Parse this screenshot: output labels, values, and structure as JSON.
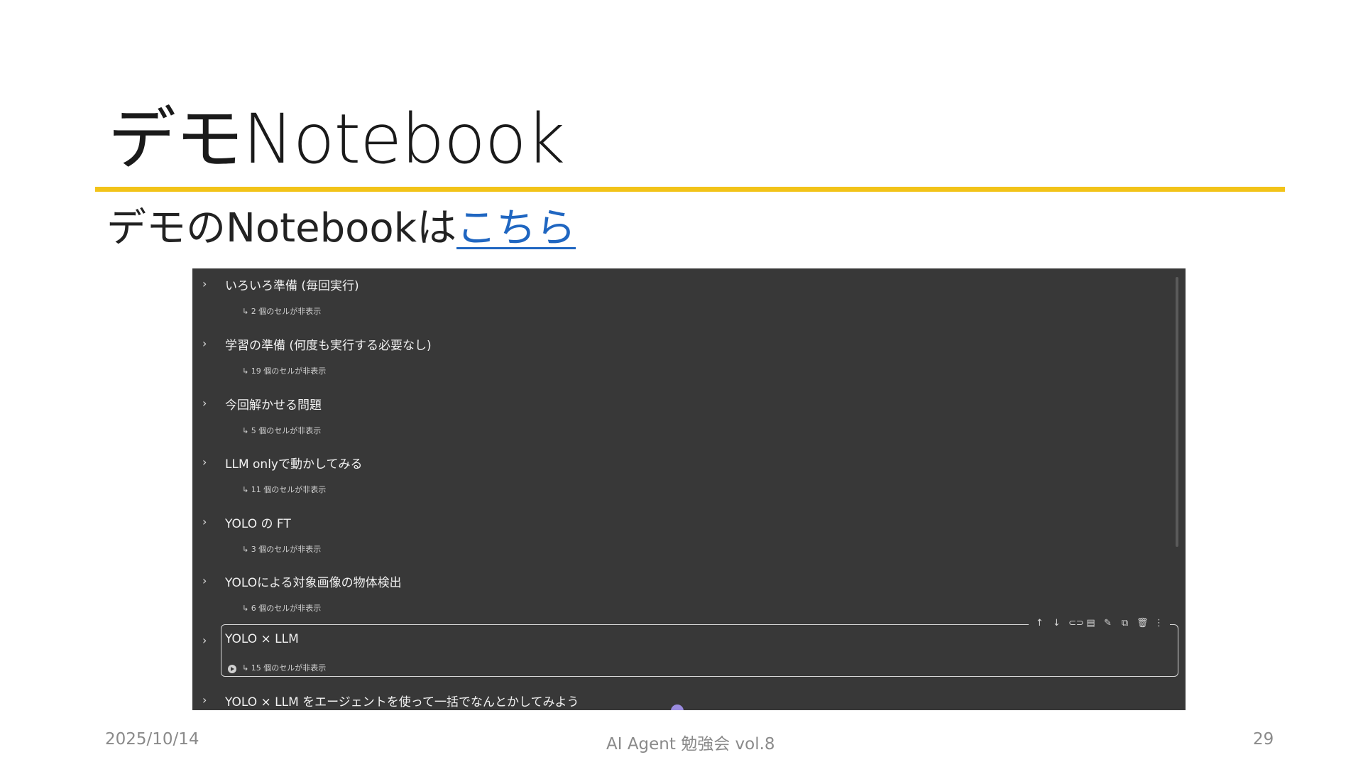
{
  "slide": {
    "title": "デモNotebook",
    "subtitle_prefix": "デモのNotebookは",
    "subtitle_link": "こちら"
  },
  "notebook": {
    "sections": [
      {
        "title": "いろいろ準備 (毎回実行)",
        "hidden": "↳ 2 個のセルが非表示"
      },
      {
        "title": "学習の準備 (何度も実行する必要なし)",
        "hidden": "↳ 19 個のセルが非表示"
      },
      {
        "title": "今回解かせる問題",
        "hidden": "↳ 5 個のセルが非表示"
      },
      {
        "title": "LLM onlyで動かしてみる",
        "hidden": "↳ 11 個のセルが非表示"
      },
      {
        "title": "YOLO の FT",
        "hidden": "↳ 3 個のセルが非表示"
      },
      {
        "title": "YOLOによる対象画像の物体検出",
        "hidden": "↳ 6 個のセルが非表示"
      },
      {
        "title": "YOLO × LLM",
        "hidden": "↳ 15 個のセルが非表示"
      },
      {
        "title": "YOLO × LLM をエージェントを使って一括でなんとかしてみよう",
        "hidden": ""
      }
    ],
    "toolbar_icons": [
      "arrow-up-icon",
      "arrow-down-icon",
      "link-icon",
      "comment-icon",
      "edit-icon",
      "copy-icon",
      "delete-icon",
      "more-icon"
    ]
  },
  "footer": {
    "date": "2025/10/14",
    "event": "AI Agent 勉強会 vol.8",
    "page": "29"
  }
}
